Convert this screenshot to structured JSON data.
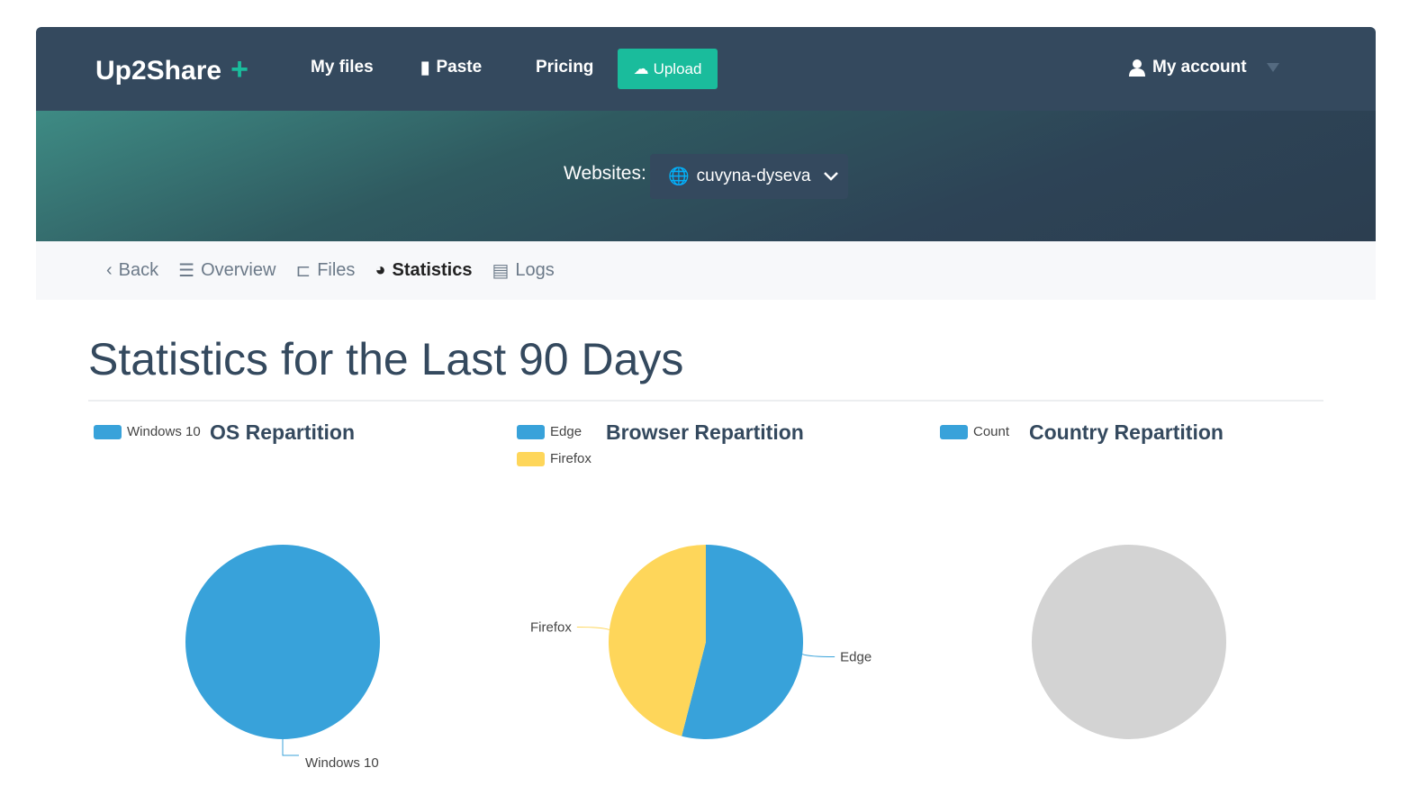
{
  "header": {
    "brand": "Up2Share",
    "brand_plus": "+",
    "nav": [
      "My files",
      "Paste",
      "Pricing"
    ],
    "upload": "Upload",
    "account": "My account"
  },
  "banner": {
    "websites_label": "Websites:",
    "selected_site": "cuvyna-dyseva"
  },
  "subnav": {
    "items": [
      "Back",
      "Overview",
      "Files",
      "Statistics",
      "Logs"
    ],
    "active": "Statistics"
  },
  "page_title": "Statistics for the Last 90 Days",
  "colors": {
    "header": "#34495e",
    "accent": "#1abc9c",
    "blue": "#38a2da",
    "yellow": "#fed65a",
    "empty": "#d3d3d3"
  },
  "chart_data": [
    {
      "type": "pie",
      "title": "OS Repartition",
      "legend": [
        "Windows 10"
      ],
      "labels": [
        "Windows 10"
      ],
      "values": [
        100
      ],
      "colors": [
        "#38a2da"
      ]
    },
    {
      "type": "pie",
      "title": "Browser Repartition",
      "legend": [
        "Edge",
        "Firefox"
      ],
      "labels": [
        "Edge",
        "Firefox"
      ],
      "values": [
        54,
        46
      ],
      "colors": [
        "#38a2da",
        "#fed65a"
      ]
    },
    {
      "type": "pie",
      "title": "Country Repartition",
      "legend": [
        "Count"
      ],
      "labels": [],
      "values": [],
      "colors": [
        "#38a2da"
      ]
    }
  ]
}
